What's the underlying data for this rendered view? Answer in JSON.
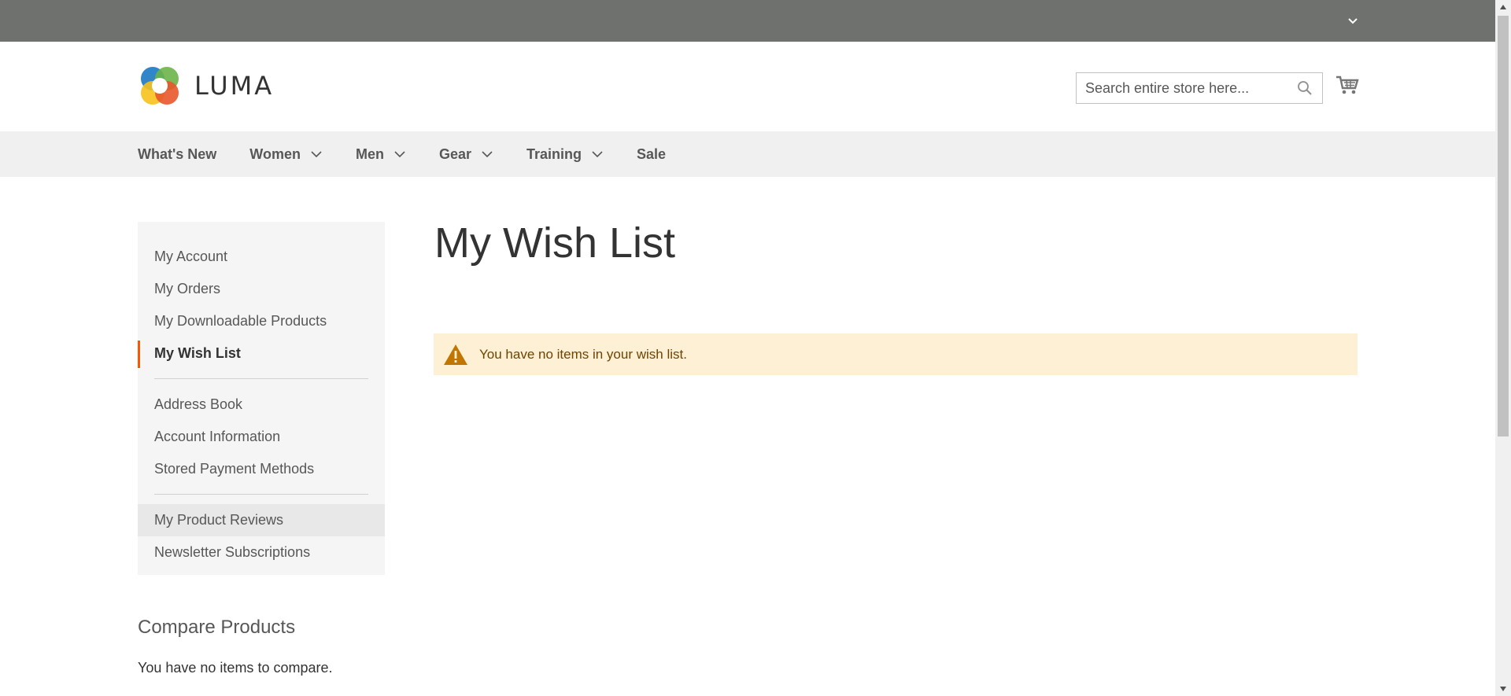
{
  "header": {
    "logo_text": "LUMA",
    "search": {
      "placeholder": "Search entire store here..."
    }
  },
  "nav": {
    "items": [
      {
        "label": "What's New",
        "has_submenu": false
      },
      {
        "label": "Women",
        "has_submenu": true
      },
      {
        "label": "Men",
        "has_submenu": true
      },
      {
        "label": "Gear",
        "has_submenu": true
      },
      {
        "label": "Training",
        "has_submenu": true
      },
      {
        "label": "Sale",
        "has_submenu": false
      }
    ]
  },
  "sidebar": {
    "group1": [
      {
        "label": "My Account"
      },
      {
        "label": "My Orders"
      },
      {
        "label": "My Downloadable Products"
      },
      {
        "label": "My Wish List",
        "current": true
      }
    ],
    "group2": [
      {
        "label": "Address Book"
      },
      {
        "label": "Account Information"
      },
      {
        "label": "Stored Payment Methods"
      }
    ],
    "group3": [
      {
        "label": "My Product Reviews"
      },
      {
        "label": "Newsletter Subscriptions"
      }
    ]
  },
  "compare": {
    "title": "Compare Products",
    "empty_message": "You have no items to compare."
  },
  "main": {
    "title": "My Wish List",
    "notice": "You have no items in your wish list."
  },
  "colors": {
    "topbar": "#6e716e",
    "nav_background": "#f0f0f0",
    "sidebar_background": "#f5f5f5",
    "active_accent": "#ff5501",
    "notice_background": "#fdf0d5",
    "notice_icon": "#c07600"
  },
  "icons": {
    "topbar_toggle": "chevron-down-icon",
    "search": "search-icon",
    "cart": "cart-icon",
    "notice": "warning-icon",
    "nav_submenu": "chevron-down-icon"
  }
}
